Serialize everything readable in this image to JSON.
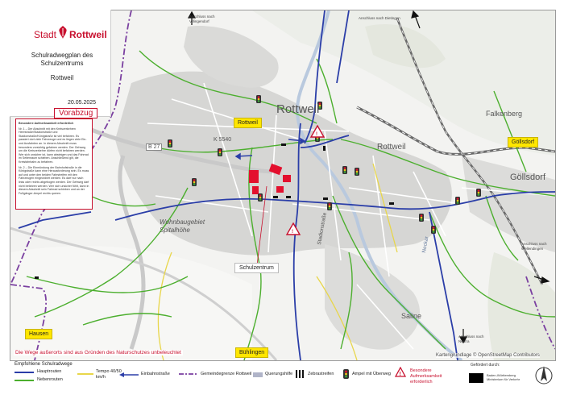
{
  "header": {
    "city_prefix": "Stadt",
    "city_name": "Rottweil",
    "title": "Schulradwegplan des Schulzentrums",
    "subtitle": "Rottweil",
    "date": "20.05.2025",
    "status": "Vorabzug"
  },
  "note": {
    "title": "Besondere Aufmerksamkeit erforderlich",
    "items": [
      "Nr. 1 – Der Abschnitt mit den Kreisverkehren Heerstraße/Stadionstraße und Stadionstraße/Königstraße ist viel befahren. Es passiert dort viele Fahrzeuge und es liegen viele Ein- und Ausfahrten an. In diesem Abschnitt muss besonders vorsichtig gefahren werden. Der Gehweg um die Kreisverkehre dürfen nicht befahren werden. Wer sich unsicher ist, kann absteigen und das Fahrrad im Seitenraum schieben. Anschließend gilt, die Kreisfahrbahn zu befahren.",
      "Nr. 2 – Die Einmündung der Bahnhofstraße in die Königstraße kann eine Herausforderung sein. Es muss auf und unter den beiden Fahrstreifen mit den Fahrzeugen eingeordnet werden. Es darf nur nach links oder rechts abgebogen werden. Der Gehweg darf nicht befahren werden. Wer sich unsicher fühlt, kann in diesem Abschnitt sein Fahrrad schieben und an der Fußgänger-Ampel rechts queren."
    ]
  },
  "places": {
    "rottweil_box": "Rottweil",
    "goellsdorf_box": "Göllsdorf",
    "hausen_box": "Hausen",
    "buehlingen_box": "Bühlingen",
    "schulzentrum": "Schulzentrum"
  },
  "map_labels": {
    "city": "Rottweil",
    "city_east": "Rottweil",
    "falkenberg": "Falkenberg",
    "goellsdorf": "Göllsdorf",
    "wohngebiet": "Wohnbaugebiet Spitalhöhe",
    "saline": "Saline",
    "b27": "B 27",
    "k5540": "K 5540",
    "stadionstr": "Stadionstraße",
    "neckar": "Neckar"
  },
  "external_notes": {
    "villingendorf": "Anschluss nach Villingendorf",
    "dietingen": "Anschluss nach Dietingen",
    "wellendingen": "Anschluss nach Wellendingen",
    "neufra": "Anschluss nach Neufra"
  },
  "bottom_note": "Die Wege außerorts sind aus Gründen des Naturschutzes unbeleuchtet",
  "attribution": "Kartengrundlage © OpenStreetMap Contributors",
  "legend": {
    "heading": "Empfohlene Schulradwege",
    "main_routes": "Hauptrouten",
    "side_routes": "Nebenrouten",
    "tempo": "Tempo 40/50 km/h",
    "one_way": "Einbahnstraße",
    "boundary": "Gemeindegrenze Rottweil",
    "crossing_aid": "Querungshilfe",
    "zebra": "Zebrastreifen",
    "traffic_light": "Ampel mit Überweg",
    "attention": "Besondere Aufmerksamkeit erforderlich",
    "sponsor_label": "Gefördert durch:",
    "sponsor_name": "Baden-Württemberg Ministerium für Verkehr",
    "north": "N"
  },
  "colors": {
    "main_route": "#2b3ea8",
    "side_route": "#4caf2e",
    "tempo": "#e8d64a",
    "boundary": "#7a3fa0",
    "accent_red": "#c8102e",
    "highlight": "#ffe600"
  }
}
